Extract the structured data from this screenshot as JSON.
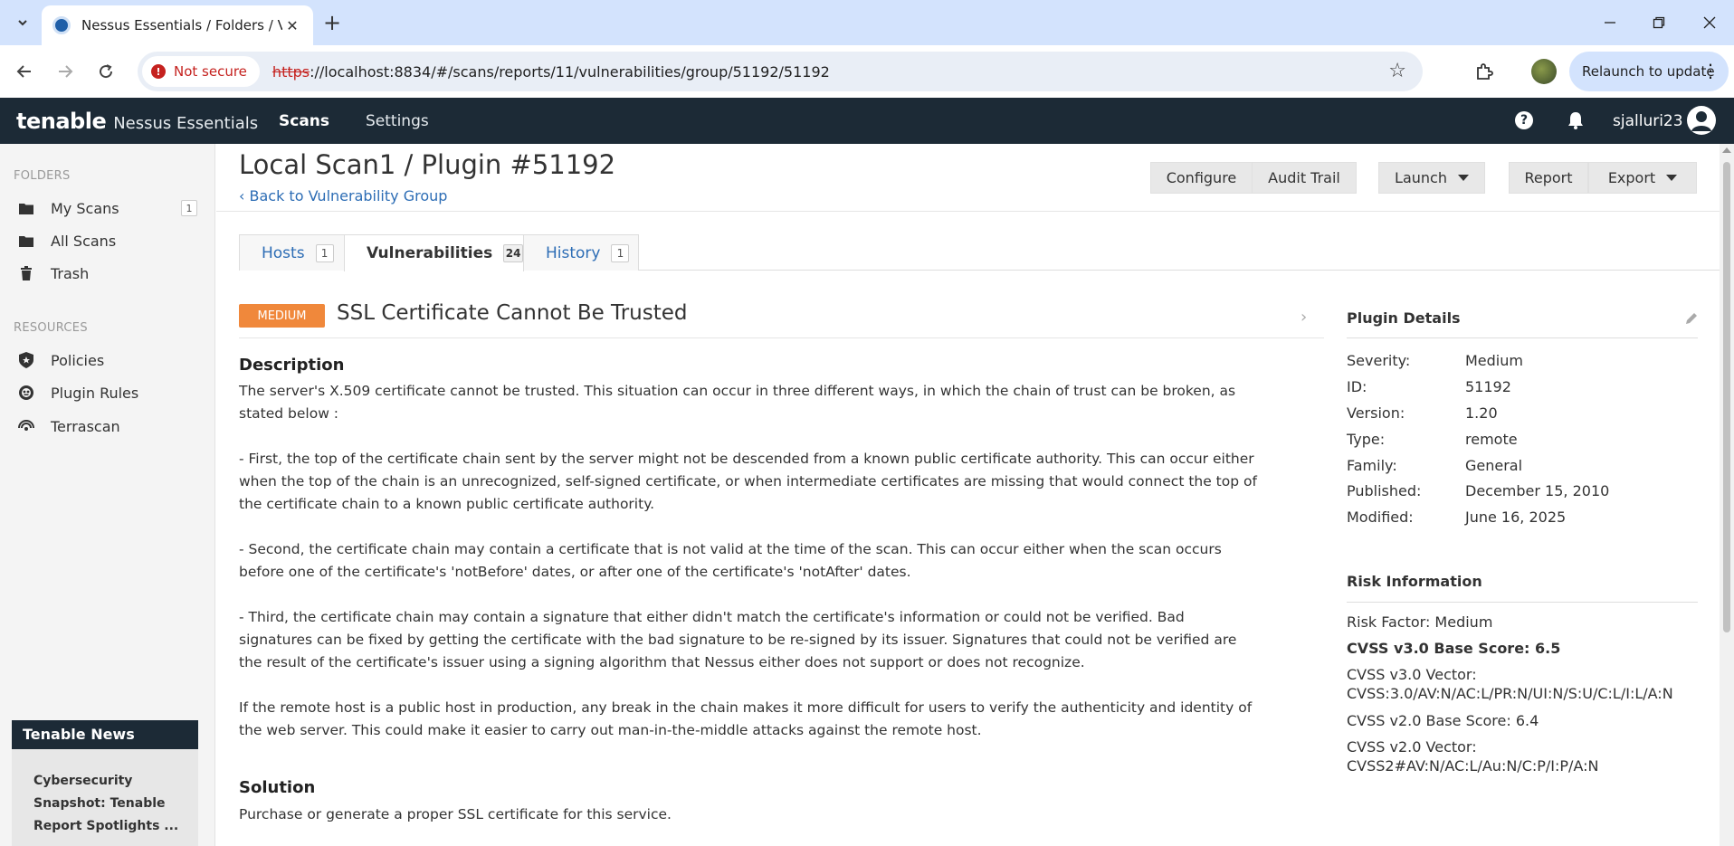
{
  "browser": {
    "tab_title": "Nessus Essentials / Folders / Vi",
    "not_secure": "Not secure",
    "url_scheme": "https",
    "url_rest": "://localhost:8834/#/scans/reports/11/vulnerabilities/group/51192/51192",
    "relaunch": "Relaunch to update"
  },
  "app": {
    "brand_logo": "tenable",
    "brand_product": "Nessus Essentials",
    "nav": [
      "Scans",
      "Settings"
    ],
    "username": "sjalluri23"
  },
  "sidebar": {
    "folders_label": "FOLDERS",
    "folders": [
      {
        "label": "My Scans",
        "count": "1"
      },
      {
        "label": "All Scans"
      },
      {
        "label": "Trash"
      }
    ],
    "resources_label": "RESOURCES",
    "resources": [
      {
        "label": "Policies"
      },
      {
        "label": "Plugin Rules"
      },
      {
        "label": "Terrascan"
      }
    ],
    "news": {
      "title": "Tenable News",
      "body": "Cybersecurity Snapshot: Tenable Report Spotlights ..."
    }
  },
  "header": {
    "title": "Local Scan1 / Plugin #51192",
    "back_link": "Back to Vulnerability Group",
    "buttons": {
      "configure": "Configure",
      "audit_trail": "Audit Trail",
      "launch": "Launch",
      "report": "Report",
      "export": "Export"
    }
  },
  "tabs": [
    {
      "label": "Hosts",
      "count": "1"
    },
    {
      "label": "Vulnerabilities",
      "count": "24"
    },
    {
      "label": "History",
      "count": "1"
    }
  ],
  "vuln": {
    "severity": "MEDIUM",
    "title": "SSL Certificate Cannot Be Trusted",
    "description_heading": "Description",
    "description": [
      "The server's X.509 certificate cannot be trusted. This situation can occur in three different ways, in which the chain of trust can be broken, as stated below :",
      "- First, the top of the certificate chain sent by the server might not be descended from a known public certificate authority. This can occur either when the top of the chain is an unrecognized, self-signed certificate, or when intermediate certificates are missing that would connect the top of the certificate chain to a known public certificate authority.",
      "- Second, the certificate chain may contain a certificate that is not valid at the time of the scan. This can occur either when the scan occurs before one of the certificate's 'notBefore' dates, or after one of the certificate's 'notAfter' dates.",
      "- Third, the certificate chain may contain a signature that either didn't match the certificate's information or could not be verified. Bad signatures can be fixed by getting the certificate with the bad signature to be re-signed by its issuer. Signatures that could not be verified are the result of the certificate's issuer using a signing algorithm that Nessus either does not support or does not recognize.",
      "If the remote host is a public host in production, any break in the chain makes it more difficult for users to verify the authenticity and identity of the web server. This could make it easier to carry out man-in-the-middle attacks against the remote host."
    ],
    "solution_heading": "Solution",
    "solution": "Purchase or generate a proper SSL certificate for this service."
  },
  "plugin_details": {
    "heading": "Plugin Details",
    "rows": [
      {
        "key": "Severity:",
        "value": "Medium"
      },
      {
        "key": "ID:",
        "value": "51192"
      },
      {
        "key": "Version:",
        "value": "1.20"
      },
      {
        "key": "Type:",
        "value": "remote"
      },
      {
        "key": "Family:",
        "value": "General"
      },
      {
        "key": "Published:",
        "value": "December 15, 2010"
      },
      {
        "key": "Modified:",
        "value": "June 16, 2025"
      }
    ]
  },
  "risk": {
    "heading": "Risk Information",
    "risk_factor": "Risk Factor: Medium",
    "cvss3_base": "CVSS v3.0 Base Score: 6.5",
    "cvss3_vector_label": "CVSS v3.0 Vector:",
    "cvss3_vector": "CVSS:3.0/AV:N/AC:L/PR:N/UI:N/S:U/C:L/I:L/A:N",
    "cvss2_base": "CVSS v2.0 Base Score: 6.4",
    "cvss2_vector_label": "CVSS v2.0 Vector:",
    "cvss2_vector": "CVSS2#AV:N/AC:L/Au:N/C:P/I:P/A:N"
  },
  "colors": {
    "header_bg": "#1c2a36",
    "severity_medium": "#f0883b",
    "link": "#2d6db5"
  }
}
